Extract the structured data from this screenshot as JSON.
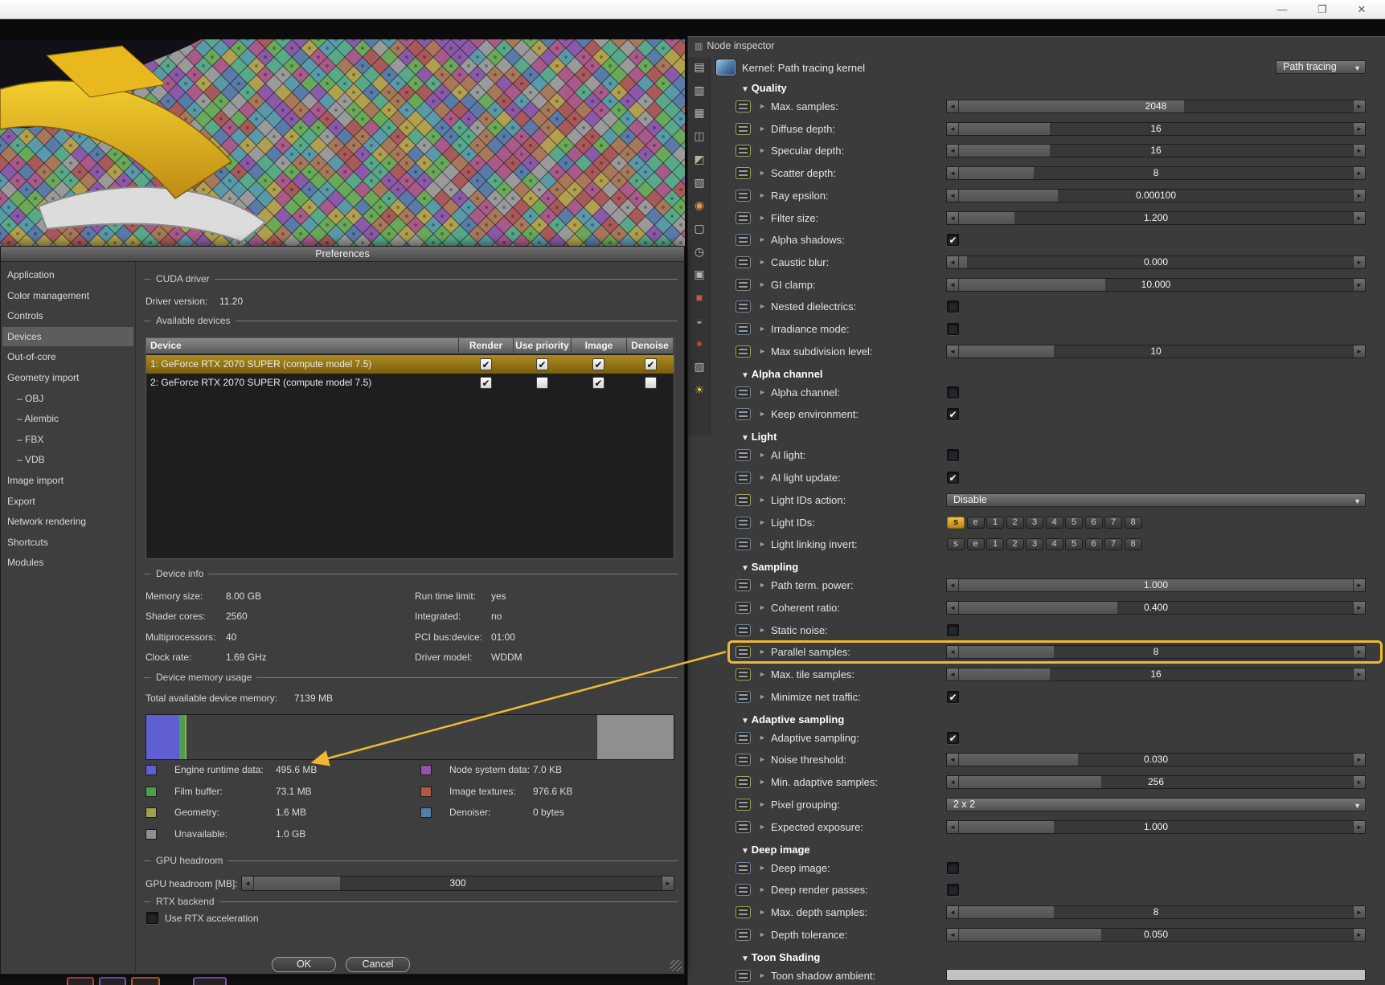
{
  "title_bar": {
    "minimize": "—",
    "maximize": "❐",
    "close": "✕"
  },
  "viewport": {
    "palette": [
      "#a85a5a",
      "#5a7aa8",
      "#5aa88a",
      "#b0a050",
      "#8a5aa8",
      "#a8785a",
      "#6aa85a",
      "#a85a88",
      "#5a9aa8",
      "#9a9a9a"
    ]
  },
  "side_toolbar": [
    {
      "name": "node-stack-icon",
      "glyph": "▤",
      "color": "#c6c6c6"
    },
    {
      "name": "outliner-icon",
      "glyph": "▥",
      "color": "#c6c6c6"
    },
    {
      "name": "render-image-icon",
      "glyph": "▦",
      "color": "#b4b4b4"
    },
    {
      "name": "save-image-icon",
      "glyph": "◫",
      "color": "#b4b4b4"
    },
    {
      "name": "kernel-node-icon",
      "glyph": "◩",
      "color": "#a8b89a"
    },
    {
      "name": "film-settings-icon",
      "glyph": "▧",
      "color": "#b4b4b4"
    },
    {
      "name": "render-layer-icon",
      "glyph": "◉",
      "color": "#d89a50"
    },
    {
      "name": "frame-icon",
      "glyph": "▢",
      "color": "#cfcfcf"
    },
    {
      "name": "animation-clock-icon",
      "glyph": "◷",
      "color": "#b8c8d8"
    },
    {
      "name": "picture-icon",
      "glyph": "▣",
      "color": "#b4b4b4"
    },
    {
      "name": "post-fx-icon",
      "glyph": "■",
      "color": "#c05a46"
    },
    {
      "name": "environment-icon",
      "glyph": "◒",
      "color": "#7a9ab8"
    },
    {
      "name": "material-ball-icon",
      "glyph": "●",
      "color": "#c04632"
    },
    {
      "name": "texture-icon",
      "glyph": "▨",
      "color": "#b4b4b4"
    },
    {
      "name": "daylight-icon",
      "glyph": "☀",
      "color": "#e8c83a"
    }
  ],
  "preferences": {
    "title": "Preferences",
    "sidebar": [
      {
        "label": "Application"
      },
      {
        "label": "Color management"
      },
      {
        "label": "Controls"
      },
      {
        "label": "Devices",
        "selected": true
      },
      {
        "label": "Out-of-core"
      },
      {
        "label": "Geometry import"
      },
      {
        "label": "OBJ",
        "indent": true
      },
      {
        "label": "Alembic",
        "indent": true
      },
      {
        "label": "FBX",
        "indent": true
      },
      {
        "label": "VDB",
        "indent": true
      },
      {
        "label": "Image import"
      },
      {
        "label": "Export"
      },
      {
        "label": "Network rendering"
      },
      {
        "label": "Shortcuts"
      },
      {
        "label": "Modules"
      }
    ],
    "cuda": {
      "section": "CUDA driver",
      "label": "Driver version:",
      "value": "11.20"
    },
    "devices": {
      "section": "Available devices",
      "columns": [
        "Device",
        "Render",
        "Use priority",
        "Image",
        "Denoise"
      ],
      "rows": [
        {
          "device": "1: GeForce RTX 2070 SUPER (compute model 7.5)",
          "render": true,
          "use_priority": true,
          "image": true,
          "denoise": true,
          "selected": true
        },
        {
          "device": "2: GeForce RTX 2070 SUPER (compute model 7.5)",
          "render": true,
          "use_priority": false,
          "image": true,
          "denoise": false,
          "selected": false
        }
      ]
    },
    "device_info": {
      "section": "Device info",
      "left": [
        [
          "Memory size:",
          "8.00 GB"
        ],
        [
          "Shader cores:",
          "2560"
        ],
        [
          "Multiprocessors:",
          "40"
        ],
        [
          "Clock rate:",
          "1.69 GHz"
        ]
      ],
      "right": [
        [
          "Run time limit:",
          "yes"
        ],
        [
          "Integrated:",
          "no"
        ],
        [
          "PCI bus:device:",
          "01:00"
        ],
        [
          "Driver model:",
          "WDDM"
        ]
      ]
    },
    "memory": {
      "section": "Device memory usage",
      "total_label": "Total available device memory:",
      "total_value": "7139 MB",
      "bar_segments": [
        {
          "name": "engine-runtime",
          "color": "#5f5fd3",
          "pct": 6.3
        },
        {
          "name": "film-buffer",
          "color": "#4f9e4f",
          "pct": 1.0
        },
        {
          "name": "geometry",
          "color": "#a0a050",
          "pct": 0.4
        },
        {
          "name": "free",
          "color": "#3f3f3f",
          "pct": 77.8
        },
        {
          "name": "unavailable",
          "color": "#8f8f8f",
          "pct": 14.5
        }
      ],
      "legend_left": [
        {
          "color": "#5f5fd3",
          "label": "Engine runtime data:",
          "value": "495.6 MB"
        },
        {
          "color": "#4f9e4f",
          "label": "Film buffer:",
          "value": "73.1 MB"
        },
        {
          "color": "#a0a050",
          "label": "Geometry:",
          "value": "1.6 MB"
        },
        {
          "color": "#8f8f8f",
          "label": "Unavailable:",
          "value": "1.0 GB"
        }
      ],
      "legend_right": [
        {
          "color": "#9055a5",
          "label": "Node system data:",
          "value": "7.0 KB"
        },
        {
          "color": "#b05a46",
          "label": "Image textures:",
          "value": "976.6 KB"
        },
        {
          "color": "#557fa5",
          "label": "Denoiser:",
          "value": "0 bytes"
        }
      ]
    },
    "gpu_headroom": {
      "section": "GPU headroom",
      "label": "GPU headroom [MB]:",
      "value": "300",
      "fill_pct": 21
    },
    "rtx": {
      "section": "RTX backend",
      "label": "Use RTX acceleration",
      "checked": false
    },
    "buttons": {
      "ok": "OK",
      "cancel": "Cancel"
    }
  },
  "node_inspector": {
    "tab": "Node inspector",
    "kernel_label": "Kernel: Path tracing kernel",
    "kernel_value": "Path tracing",
    "rows": [
      {
        "t": "header",
        "label": "Quality"
      },
      {
        "t": "slider",
        "label": "Max. samples:",
        "value": "2048",
        "fill": 57,
        "icon": "num"
      },
      {
        "t": "slider",
        "label": "Diffuse depth:",
        "value": "16",
        "fill": 23,
        "icon": "num"
      },
      {
        "t": "slider",
        "label": "Specular depth:",
        "value": "16",
        "fill": 23,
        "icon": "num"
      },
      {
        "t": "slider",
        "label": "Scatter depth:",
        "value": "8",
        "fill": 19,
        "icon": "num"
      },
      {
        "t": "slider",
        "label": "Ray epsilon:",
        "value": "0.000100",
        "fill": 25,
        "icon": "float"
      },
      {
        "t": "slider",
        "label": "Filter size:",
        "value": "1.200",
        "fill": 14,
        "icon": "float"
      },
      {
        "t": "check",
        "label": "Alpha shadows:",
        "checked": true,
        "icon": "bool"
      },
      {
        "t": "slider",
        "label": "Caustic blur:",
        "value": "0.000",
        "fill": 2,
        "icon": "float"
      },
      {
        "t": "slider",
        "label": "GI clamp:",
        "value": "10.000",
        "fill": 37,
        "icon": "float"
      },
      {
        "t": "check",
        "label": "Nested dielectrics:",
        "checked": false,
        "icon": "bool"
      },
      {
        "t": "check",
        "label": "Irradiance mode:",
        "checked": false,
        "icon": "bool"
      },
      {
        "t": "slider",
        "label": "Max subdivision level:",
        "value": "10",
        "fill": 24,
        "icon": "num"
      },
      {
        "t": "header",
        "label": "Alpha channel"
      },
      {
        "t": "check",
        "label": "Alpha channel:",
        "checked": false,
        "icon": "bool"
      },
      {
        "t": "check",
        "label": "Keep environment:",
        "checked": true,
        "icon": "bool"
      },
      {
        "t": "header",
        "label": "Light"
      },
      {
        "t": "check",
        "label": "AI light:",
        "checked": false,
        "icon": "bool"
      },
      {
        "t": "check",
        "label": "AI light update:",
        "checked": true,
        "icon": "bool"
      },
      {
        "t": "dropdown",
        "label": "Light IDs action:",
        "value": "Disable",
        "icon": "num"
      },
      {
        "t": "lightids",
        "label": "Light IDs:",
        "buttons": [
          "s",
          "e",
          "1",
          "2",
          "3",
          "4",
          "5",
          "6",
          "7",
          "8"
        ],
        "active": [
          0
        ],
        "icon": "bool"
      },
      {
        "t": "lightids",
        "label": "Light linking invert:",
        "buttons": [
          "s",
          "e",
          "1",
          "2",
          "3",
          "4",
          "5",
          "6",
          "7",
          "8"
        ],
        "active": [],
        "icon": "bool"
      },
      {
        "t": "header",
        "label": "Sampling"
      },
      {
        "t": "slider",
        "label": "Path term. power:",
        "value": "1.000",
        "fill": 100,
        "icon": "float"
      },
      {
        "t": "slider",
        "label": "Coherent ratio:",
        "value": "0.400",
        "fill": 40,
        "icon": "float"
      },
      {
        "t": "check",
        "label": "Static noise:",
        "checked": false,
        "icon": "bool"
      },
      {
        "t": "slider",
        "label": "Parallel samples:",
        "value": "8",
        "fill": 24,
        "icon": "num",
        "highlight": true
      },
      {
        "t": "slider",
        "label": "Max. tile samples:",
        "value": "16",
        "fill": 23,
        "icon": "num"
      },
      {
        "t": "check",
        "label": "Minimize net traffic:",
        "checked": true,
        "icon": "bool"
      },
      {
        "t": "header",
        "label": "Adaptive sampling"
      },
      {
        "t": "check",
        "label": "Adaptive sampling:",
        "checked": true,
        "icon": "bool"
      },
      {
        "t": "slider",
        "label": "Noise threshold:",
        "value": "0.030",
        "fill": 30,
        "icon": "float"
      },
      {
        "t": "slider",
        "label": "Min. adaptive samples:",
        "value": "256",
        "fill": 36,
        "icon": "num"
      },
      {
        "t": "dropdown",
        "label": "Pixel grouping:",
        "value": "2 x 2",
        "icon": "num"
      },
      {
        "t": "slider",
        "label": "Expected exposure:",
        "value": "1.000",
        "fill": 24,
        "icon": "float"
      },
      {
        "t": "header",
        "label": "Deep image"
      },
      {
        "t": "check",
        "label": "Deep image:",
        "checked": false,
        "icon": "bool"
      },
      {
        "t": "check",
        "label": "Deep render passes:",
        "checked": false,
        "icon": "bool"
      },
      {
        "t": "slider",
        "label": "Max. depth samples:",
        "value": "8",
        "fill": 24,
        "icon": "num"
      },
      {
        "t": "slider",
        "label": "Depth tolerance:",
        "value": "0.050",
        "fill": 36,
        "icon": "float"
      },
      {
        "t": "header",
        "label": "Toon Shading"
      },
      {
        "t": "color",
        "label": "Toon shadow ambient:",
        "color": "#c2c2c2",
        "icon": "float"
      }
    ]
  },
  "annotation": {
    "color": "#eeb832",
    "highlighted_parameter": "Parallel samples:",
    "arrow_target": "Engine runtime data:"
  },
  "bottom_nodes": [
    {
      "color": "#c84848"
    },
    {
      "color": "#9050c8"
    },
    {
      "color": "#c86038"
    },
    {
      "color": "#9050c8"
    }
  ]
}
